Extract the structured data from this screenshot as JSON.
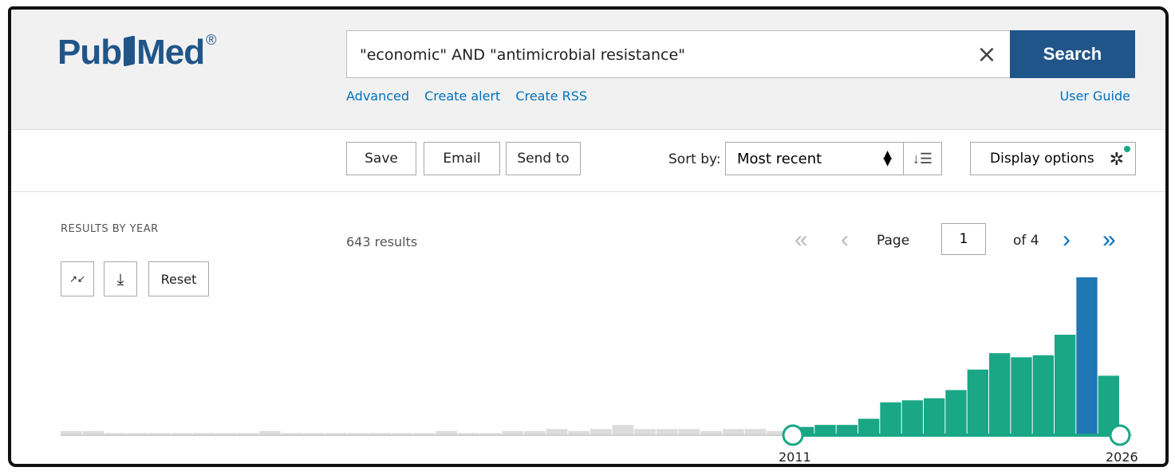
{
  "logo": {
    "text": "PubMed",
    "registered": "®"
  },
  "search": {
    "query": "\"economic\" AND \"antimicrobial resistance\"",
    "search_label": "Search",
    "clear_symbol": "×"
  },
  "header_links": {
    "advanced": "Advanced",
    "create_alert": "Create alert",
    "create_rss": "Create RSS",
    "user_guide": "User Guide"
  },
  "toolbar": {
    "save": "Save",
    "email": "Email",
    "send_to": "Send to",
    "sort_by_label": "Sort by:",
    "sort_value": "Most recent",
    "display_options": "Display options"
  },
  "results_by_year": {
    "title": "RESULTS BY YEAR",
    "reset": "Reset"
  },
  "results": {
    "count": "643 results"
  },
  "pagination": {
    "page_label": "Page",
    "current": "1",
    "of": "of 4"
  },
  "chart_data": {
    "type": "bar",
    "title": "",
    "range_start_label": "2011",
    "range_end_label": "2026",
    "selected_color": "#1aa786",
    "unselected_color": "#dcdcdc",
    "values_unselected": [
      2,
      2,
      1,
      1,
      1,
      1,
      1,
      1,
      1,
      2,
      1,
      1,
      1,
      1,
      1,
      1,
      1,
      2,
      1,
      1,
      2,
      2,
      3,
      2,
      3,
      5,
      3,
      3,
      3,
      2,
      3,
      3,
      2
    ],
    "values_selected": [
      4,
      5,
      5,
      8,
      16,
      17,
      18,
      22,
      32,
      40,
      38,
      39,
      49,
      77,
      29
    ]
  }
}
